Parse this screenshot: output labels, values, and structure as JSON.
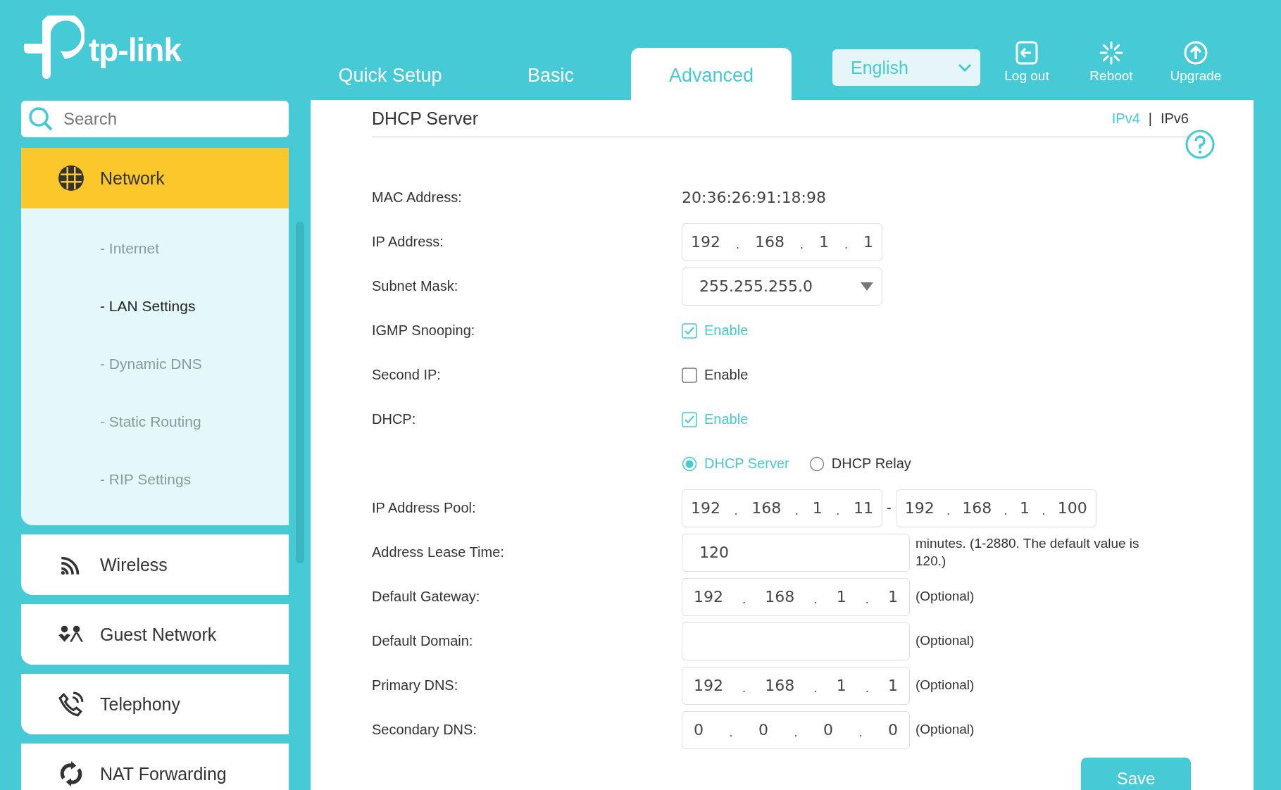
{
  "header": {
    "logo_text": "tp-link",
    "tabs": [
      {
        "label": "Quick Setup",
        "selected": false
      },
      {
        "label": "Basic",
        "selected": false
      },
      {
        "label": "Advanced",
        "selected": true
      }
    ],
    "language": {
      "value": "English"
    },
    "actions": [
      {
        "label": "Log out",
        "kind": "logout"
      },
      {
        "label": "Reboot",
        "kind": "reboot"
      },
      {
        "label": "Upgrade",
        "kind": "upgrade"
      }
    ]
  },
  "sidebar": {
    "search": {
      "placeholder": "Search"
    },
    "items": [
      {
        "label": "Network",
        "selected": true,
        "expanded": true,
        "children": [
          {
            "label": "- Internet",
            "selected": false
          },
          {
            "label": "- LAN Settings",
            "selected": true
          },
          {
            "label": "- Dynamic DNS",
            "selected": false
          },
          {
            "label": "- Static Routing",
            "selected": false
          },
          {
            "label": "- RIP Settings",
            "selected": false
          }
        ]
      },
      {
        "label": "Wireless",
        "selected": false,
        "expanded": false
      },
      {
        "label": "Guest Network",
        "selected": false,
        "expanded": false
      },
      {
        "label": "Telephony",
        "selected": false,
        "expanded": false
      },
      {
        "label": "NAT Forwarding",
        "selected": false,
        "expanded": false
      }
    ]
  },
  "panel": {
    "title": "DHCP Server",
    "versions": [
      {
        "label": "IPv4",
        "selected": true
      },
      {
        "label": "IPv6",
        "selected": false
      }
    ],
    "version_separator": "|",
    "rows": [
      {
        "kind": "text",
        "label": "MAC Address:",
        "value": "20:36:26:91:18:98"
      },
      {
        "kind": "ip",
        "label": "IP Address:",
        "parts": [
          "192",
          ".",
          "168",
          ".",
          "1",
          ".",
          "1"
        ]
      },
      {
        "kind": "select",
        "label": "Subnet Mask:",
        "value": "255.255.255.0"
      },
      {
        "kind": "checkbox",
        "label": "IGMP Snooping:",
        "option": "Enable",
        "checked": true
      },
      {
        "kind": "checkbox",
        "label": "Second IP:",
        "option": "Enable",
        "checked": false
      },
      {
        "kind": "checkbox",
        "label": "DHCP:",
        "option": "Enable",
        "checked": true
      },
      {
        "kind": "radio",
        "options": [
          {
            "label": "DHCP Server",
            "selected": true
          },
          {
            "label": "DHCP Relay",
            "selected": false
          }
        ]
      },
      {
        "kind": "ip_range",
        "label": "IP Address Pool:",
        "from": [
          "192",
          ".",
          "168",
          ".",
          "1",
          ".",
          "11"
        ],
        "separator": "-",
        "to": [
          "192",
          ".",
          "168",
          ".",
          "1",
          ".",
          "100"
        ]
      },
      {
        "kind": "input",
        "label": "Address Lease Time:",
        "value": "120",
        "note": "minutes. (1-2880. The default value is 120.)"
      },
      {
        "kind": "ip_wide",
        "label": "Default Gateway:",
        "parts": [
          "192",
          ".",
          "168",
          ".",
          "1",
          ".",
          "1"
        ],
        "note": "(Optional)"
      },
      {
        "kind": "input",
        "label": "Default Domain:",
        "note": "(Optional)"
      },
      {
        "kind": "ip_wide",
        "label": "Primary DNS:",
        "parts": [
          "192",
          ".",
          "168",
          ".",
          "1",
          ".",
          "1"
        ],
        "note": "(Optional)"
      },
      {
        "kind": "ip_wide",
        "label": "Secondary DNS:",
        "parts": [
          "0",
          ".",
          "0",
          ".",
          "0",
          ".",
          "0"
        ],
        "note": "(Optional)"
      }
    ],
    "save": "Save"
  }
}
